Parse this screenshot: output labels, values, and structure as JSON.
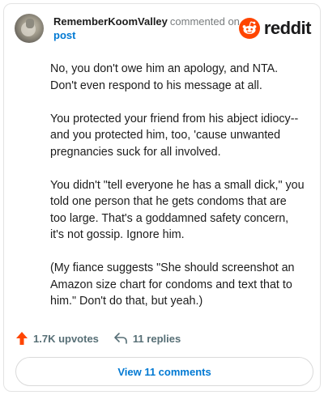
{
  "header": {
    "username": "RememberKoomValley",
    "action_text": "commented on",
    "post_link": "post",
    "logo_text": "reddit"
  },
  "comment": {
    "paragraphs": [
      "No, you don't owe him an apology, and NTA.\nDon't even respond to his message at all.",
      "You protected your friend from his abject idiocy--\nand you protected him, too, 'cause unwanted\npregnancies suck for all involved.",
      "You didn't \"tell everyone he has a small dick,\" you\ntold one person that he gets condoms that are\ntoo large. That's a goddamned safety concern,\nit's not gossip. Ignore him.",
      "(My fiance suggests \"She should screenshot an\nAmazon size chart for condoms and text that to\nhim.\" Don't do that, but yeah.)"
    ]
  },
  "actions": {
    "upvotes": "1.7K upvotes",
    "replies": "11 replies"
  },
  "view_comments_label": "View 11 comments",
  "colors": {
    "accent": "#0079d3",
    "reddit_orange": "#ff4500",
    "muted": "#576f76"
  },
  "icons": [
    "avatar",
    "reddit-logo-icon",
    "upvote-arrow-icon",
    "reply-icon"
  ]
}
